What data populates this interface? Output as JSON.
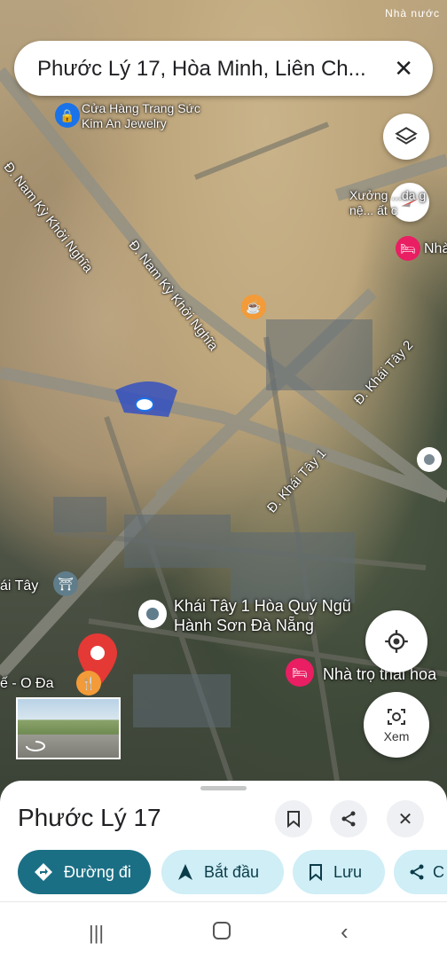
{
  "status_bar": {
    "text": "Nhà nước"
  },
  "search": {
    "query": "Phước Lý 17, Hòa Minh, Liên Ch..."
  },
  "map": {
    "labels": {
      "store": "Cửa Hàng Trang Sức Kim An Jewelry",
      "road_nam_ky_1": "Đ. Nam Kỳ Khởi Nghĩa",
      "road_nam_ky_2": "Đ. Nam Kỳ Khởi Nghĩa",
      "road_khai_tay_2": "Đ. Khái Tây 2",
      "road_khai_tay_1": "Đ. Khái Tây 1",
      "workshop": "Xưởng ...da g nệ... ất c",
      "hotel_right": "Nhà",
      "place_khai_tay": "Khái Tây 1 Hòa Quý Ngũ Hành Sơn Đà Nẵng",
      "motel": "Nhà trọ thái hoa",
      "left_tay": "ái Tây",
      "left_o_da": "ế - O Đa"
    },
    "view_button": "Xem"
  },
  "sheet": {
    "title": "Phước Lý 17",
    "actions": {
      "directions": "Đường đi",
      "start": "Bắt đầu",
      "save": "Lưu",
      "share": "C"
    }
  },
  "colors": {
    "teal": "#1b6f84",
    "chip_bg": "#cfeef6",
    "pin_red": "#e53935",
    "pink": "#e91e63",
    "orange": "#f29b38",
    "blue_dot": "#1a73e8"
  }
}
